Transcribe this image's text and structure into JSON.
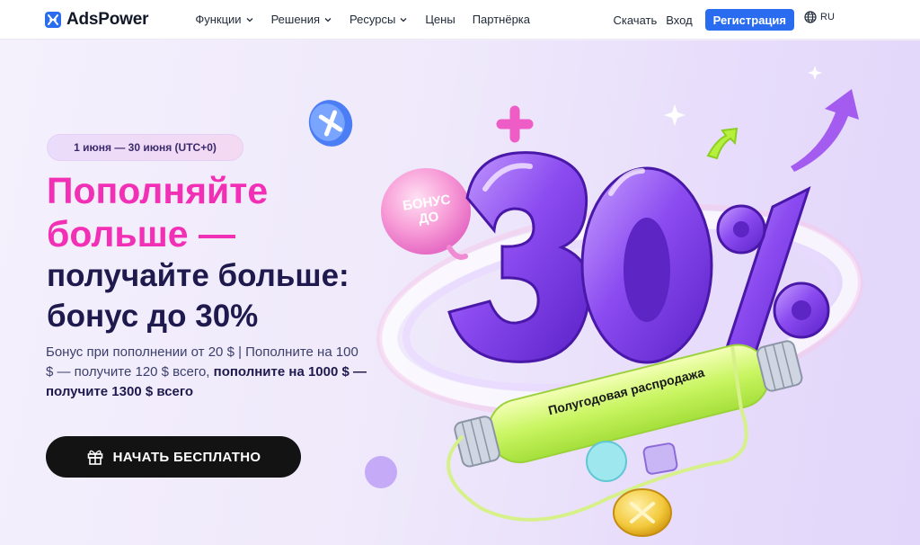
{
  "nav": {
    "brand": "AdsPower",
    "menu": [
      {
        "label": "Функции",
        "has_dropdown": true
      },
      {
        "label": "Решения",
        "has_dropdown": true
      },
      {
        "label": "Ресурсы",
        "has_dropdown": true
      },
      {
        "label": "Цены",
        "has_dropdown": false
      },
      {
        "label": "Партнёрка",
        "has_dropdown": false
      }
    ],
    "download": "Скачать",
    "login": "Вход",
    "register": "Регистрация",
    "language": "RU"
  },
  "hero": {
    "date_range": "1 июня — 30 июня (UTC+0)",
    "headline_line1": "Пополняйте",
    "headline_line2": "больше —",
    "headline_line3": "получайте больше:",
    "headline_line4": "бонус до 30%",
    "desc_normal": "Бонус при пополнении от 20 $ | Пополните на 100 $ — получите 120 $ всего, ",
    "desc_bold": "пополните на 1000 $ — получите 1300 $ всего",
    "cta_label": "НАЧАТЬ БЕСПЛАТНО",
    "badge_text_1": "БОНУС",
    "badge_text_2": "ДО",
    "big_number": "30%",
    "tube_label": "Полугодовая распродажа"
  },
  "colors": {
    "brand_blue": "#2a6cf0",
    "headline_pink": "#f230b6",
    "headline_dark": "#1f1a4d",
    "cta_bg": "#131313",
    "balloon_purple": "#8b4bf0"
  }
}
